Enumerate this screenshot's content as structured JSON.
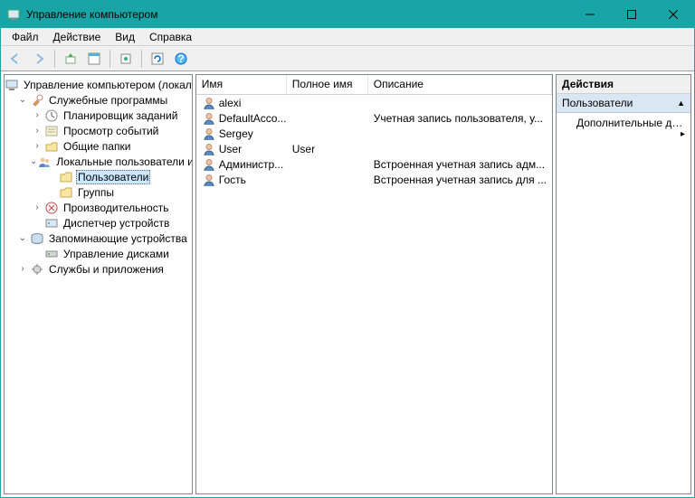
{
  "window": {
    "title": "Управление компьютером"
  },
  "menubar": {
    "file": "Файл",
    "action": "Действие",
    "view": "Вид",
    "help": "Справка"
  },
  "tree": {
    "root": "Управление компьютером (локальным)",
    "system_tools": "Служебные программы",
    "task_scheduler": "Планировщик заданий",
    "event_viewer": "Просмотр событий",
    "shared_folders": "Общие папки",
    "local_users_groups": "Локальные пользователи и группы",
    "users": "Пользователи",
    "groups": "Группы",
    "performance": "Производительность",
    "device_manager": "Диспетчер устройств",
    "storage": "Запоминающие устройства",
    "disk_management": "Управление дисками",
    "services_apps": "Службы и приложения"
  },
  "columns": {
    "name": "Имя",
    "fullname": "Полное имя",
    "description": "Описание"
  },
  "users": [
    {
      "name": "alexi",
      "fullname": "",
      "description": ""
    },
    {
      "name": "DefaultAcco...",
      "fullname": "",
      "description": "Учетная запись пользователя, у..."
    },
    {
      "name": "Sergey",
      "fullname": "",
      "description": ""
    },
    {
      "name": "User",
      "fullname": "User",
      "description": ""
    },
    {
      "name": "Администр...",
      "fullname": "",
      "description": "Встроенная учетная запись адм..."
    },
    {
      "name": "Гость",
      "fullname": "",
      "description": "Встроенная учетная запись для ..."
    }
  ],
  "actions": {
    "header": "Действия",
    "group": "Пользователи",
    "more": "Дополнительные дей..."
  },
  "colors": {
    "accent": "#19a5a5"
  }
}
